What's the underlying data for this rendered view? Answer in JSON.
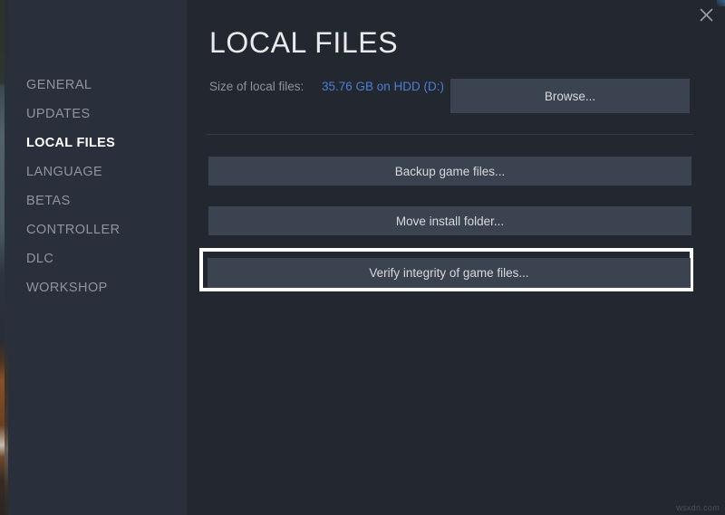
{
  "window": {
    "title": "LOCAL FILES",
    "close_icon": "close-icon",
    "watermark": "wsxdn.com"
  },
  "sidebar": {
    "items": [
      {
        "label": "GENERAL",
        "active": false
      },
      {
        "label": "UPDATES",
        "active": false
      },
      {
        "label": "LOCAL FILES",
        "active": true
      },
      {
        "label": "LANGUAGE",
        "active": false
      },
      {
        "label": "BETAS",
        "active": false
      },
      {
        "label": "CONTROLLER",
        "active": false
      },
      {
        "label": "DLC",
        "active": false
      },
      {
        "label": "WORKSHOP",
        "active": false
      }
    ]
  },
  "main": {
    "size_row": {
      "label": "Size of local files:",
      "value": "35.76 GB on HDD (D:)",
      "browse_label": "Browse..."
    },
    "actions": {
      "backup_label": "Backup game files...",
      "move_label": "Move install folder...",
      "verify_label": "Verify integrity of game files..."
    }
  },
  "colors": {
    "sidebar_bg": "#2a303b",
    "content_bg": "#23272f",
    "button_bg": "#3c4350",
    "link": "#4b7fd4",
    "highlight_border": "#ffffff",
    "active_item": "#ffffff",
    "muted_text": "#8d929b"
  }
}
